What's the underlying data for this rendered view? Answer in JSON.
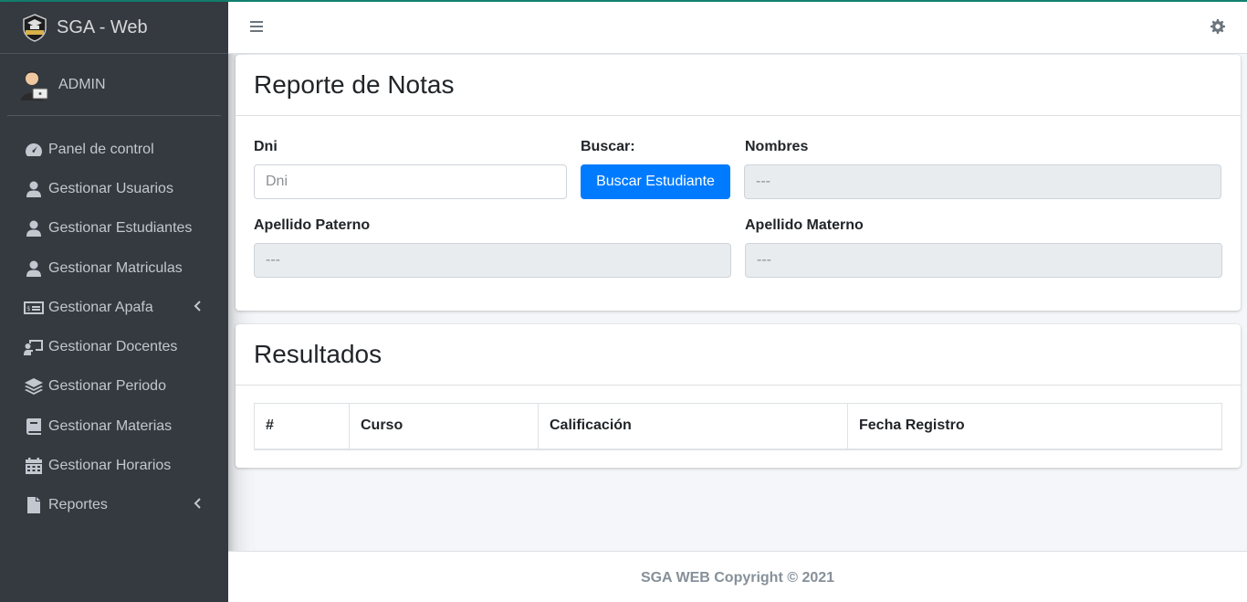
{
  "brand": {
    "title": "SGA - Web",
    "logo_icon": "college-logo-icon"
  },
  "user": {
    "name": "ADMIN",
    "avatar_icon": "admin-avatar-icon"
  },
  "sidebar": {
    "items": [
      {
        "label": "Panel de control",
        "icon": "tachometer-icon"
      },
      {
        "label": "Gestionar Usuarios",
        "icon": "user-icon"
      },
      {
        "label": "Gestionar Estudiantes",
        "icon": "user-icon"
      },
      {
        "label": "Gestionar Matriculas",
        "icon": "user-icon"
      },
      {
        "label": "Gestionar Apafa",
        "icon": "money-bill-icon",
        "has_submenu": true
      },
      {
        "label": "Gestionar Docentes",
        "icon": "chalkboard-teacher-icon"
      },
      {
        "label": "Gestionar Periodo",
        "icon": "layer-group-icon"
      },
      {
        "label": "Gestionar Materias",
        "icon": "book-icon"
      },
      {
        "label": "Gestionar Horarios",
        "icon": "calendar-icon"
      },
      {
        "label": "Reportes",
        "icon": "file-icon",
        "has_submenu": true
      }
    ]
  },
  "topbar": {
    "menu_icon": "hamburger-icon",
    "settings_icon": "gear-icon"
  },
  "report_card": {
    "title": "Reporte de Notas",
    "dni": {
      "label": "Dni",
      "placeholder": "Dni",
      "value": ""
    },
    "search": {
      "label": "Buscar:",
      "button_label": "Buscar Estudiante"
    },
    "nombres": {
      "label": "Nombres",
      "placeholder": "---"
    },
    "apellido_paterno": {
      "label": "Apellido Paterno",
      "placeholder": "---"
    },
    "apellido_materno": {
      "label": "Apellido Materno",
      "placeholder": "---"
    }
  },
  "results_card": {
    "title": "Resultados",
    "columns": [
      "#",
      "Curso",
      "Calificación",
      "Fecha Registro"
    ],
    "rows": []
  },
  "footer": {
    "text": "SGA WEB Copyright © 2021"
  },
  "colors": {
    "sidebar_bg": "#343a40",
    "primary": "#007bff",
    "accent_top": "#138070"
  }
}
